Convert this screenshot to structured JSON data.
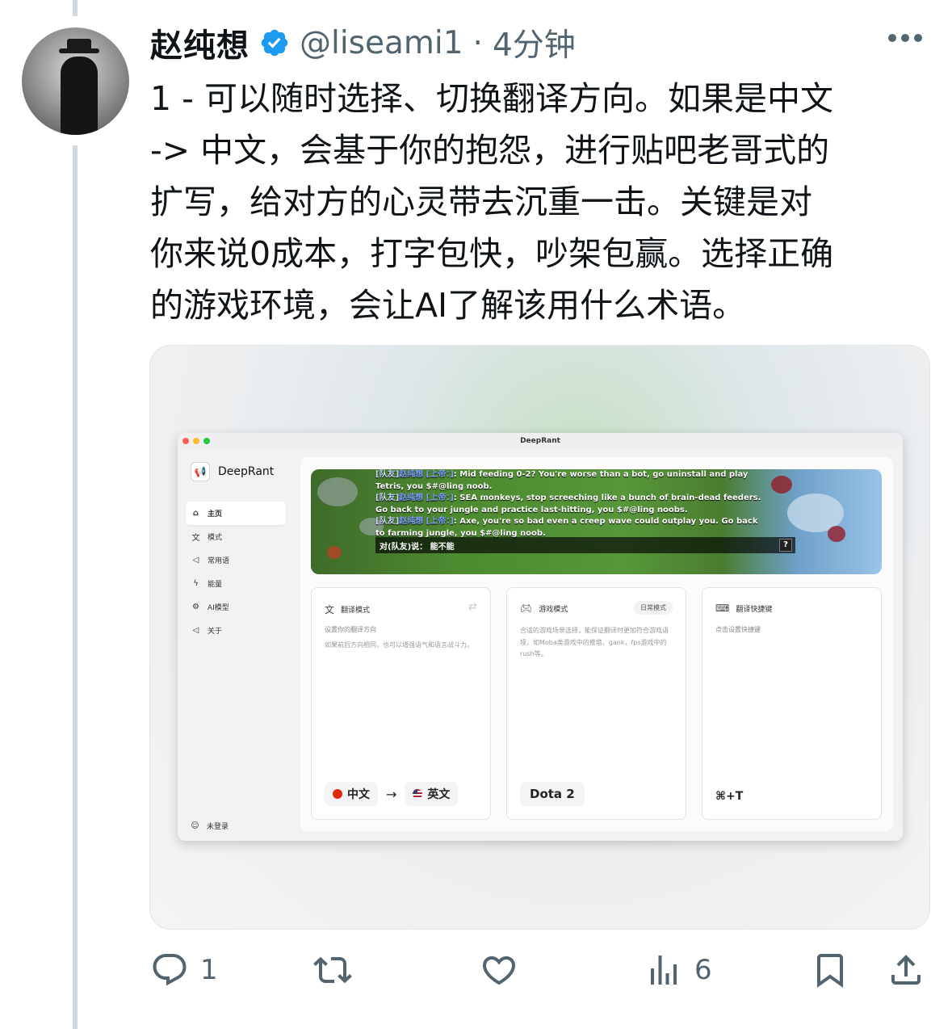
{
  "tweet": {
    "author_name": "赵纯想",
    "handle": "@liseami1",
    "separator": "·",
    "time": "4分钟",
    "text": "1 - 可以随时选择、切换翻译方向。如果是中文\n-> 中文，会基于你的抱怨，进行贴吧老哥式的\n扩写，给对方的心灵带去沉重一击。关键是对\n你来说0成本，打字包快，吵架包赢。选择正确\n的游戏环境，会让AI了解该用什么术语。",
    "verified_color": "#1d9bf0"
  },
  "actions": {
    "reply_count": "1",
    "retweet_count": "",
    "like_count": "",
    "views_count": "6"
  },
  "app": {
    "window_title": "DeepRant",
    "brand": "DeepRant",
    "nav": [
      {
        "label": "主页",
        "icon": "home-icon"
      },
      {
        "label": "模式",
        "icon": "translate-icon"
      },
      {
        "label": "常用语",
        "icon": "megaphone-icon"
      },
      {
        "label": "能量",
        "icon": "bolt-icon"
      },
      {
        "label": "AI模型",
        "icon": "gear-icon"
      },
      {
        "label": "关于",
        "icon": "megaphone-icon"
      }
    ],
    "login": "未登录",
    "game_chat": [
      {
        "tag": "[队友]",
        "user": "赵纯想 [上帝：]",
        "text": ": Mid feeding 0-2? You're worse than a bot, go uninstall and play Tetris, you $#@ling noob."
      },
      {
        "tag": "[队友]",
        "user": "赵纯想 [上帝：]",
        "text": ": SEA monkeys, stop screeching like a bunch of brain-dead feeders. Go back to your jungle and practice last-hitting, you $#@ling noobs."
      },
      {
        "tag": "[队友]",
        "user": "赵纯想 [上帝：]",
        "text": ": Axe, you're so bad even a creep wave could outplay you. Go back to farming jungle, you $#@ling noob."
      }
    ],
    "chat_input": "对(队友)说：  能不能",
    "chat_help": "?",
    "cards": {
      "translate": {
        "title": "翻译模式",
        "subtitle": "设置你的翻译方向",
        "desc": "如果前后方向相同，也可以增强语气和语言战斗力。",
        "from": "中文",
        "to": "英文",
        "arrow": "→"
      },
      "game": {
        "title": "游戏模式",
        "pill": "日常模式",
        "desc": "合适的游戏场景选择，能保证翻译时更加符合游戏语境，如Moba类游戏中的推塔、gank，fps游戏中的rush等。",
        "value": "Dota 2"
      },
      "shortcut": {
        "title": "翻译快捷键",
        "subtitle": "点击设置快捷键",
        "value": "⌘+T"
      }
    }
  }
}
